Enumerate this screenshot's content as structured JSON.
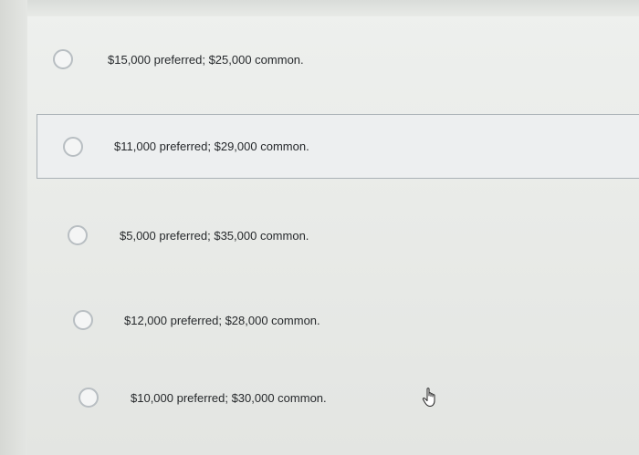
{
  "options": [
    {
      "label": "$15,000 preferred; $25,000 common.",
      "selected": false
    },
    {
      "label": "$11,000 preferred; $29,000 common.",
      "selected": true
    },
    {
      "label": "$5,000 preferred; $35,000 common.",
      "selected": false
    },
    {
      "label": "$12,000 preferred; $28,000 common.",
      "selected": false
    },
    {
      "label": "$10,000 preferred; $30,000 common.",
      "selected": false
    }
  ],
  "icons": {
    "radio": "radio-unchecked-icon",
    "cursor": "hand-pointer-icon"
  },
  "colors": {
    "background": "#e9ebe8",
    "selected_border": "#a9b1b6",
    "text": "#26292c",
    "radio_border": "#b8bec2"
  }
}
